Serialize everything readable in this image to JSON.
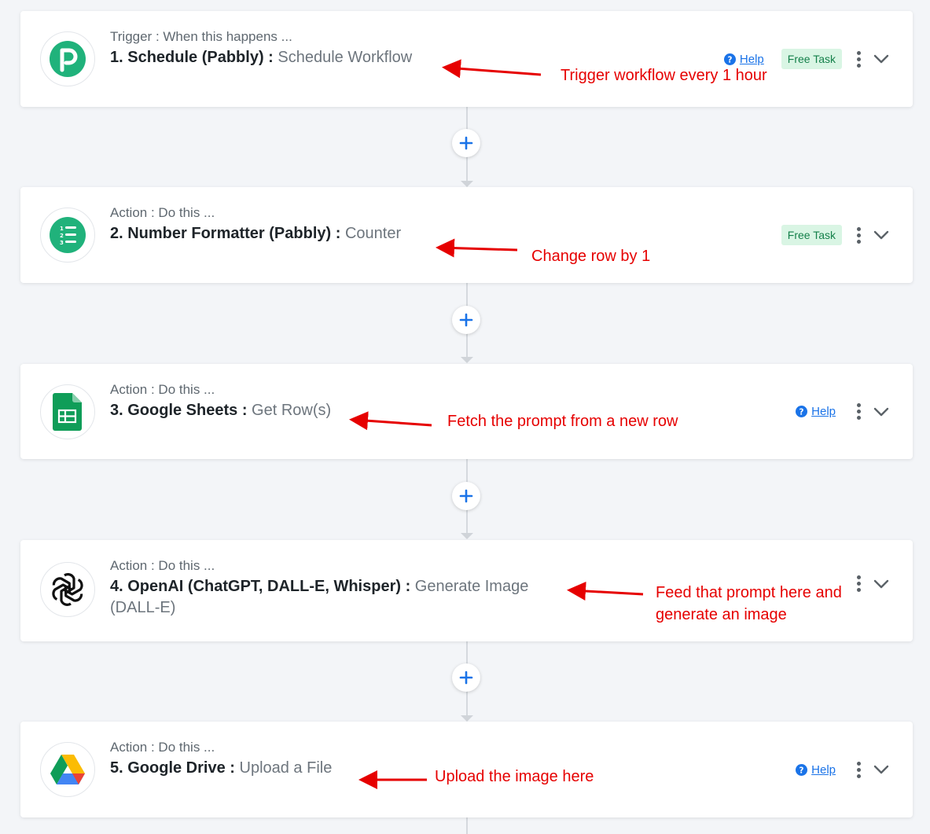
{
  "steps": [
    {
      "type_label": "Trigger : When this happens ...",
      "title": "1. Schedule (Pabbly) :",
      "event": "Schedule Workflow",
      "logo_icon": "pabbly-logo-icon",
      "show_help": true,
      "show_free": true
    },
    {
      "type_label": "Action : Do this ...",
      "title": "2. Number Formatter (Pabbly) :",
      "event": "Counter",
      "logo_icon": "number-formatter-icon",
      "show_help": false,
      "show_free": true
    },
    {
      "type_label": "Action : Do this ...",
      "title": "3. Google Sheets :",
      "event": "Get Row(s)",
      "logo_icon": "google-sheets-icon",
      "show_help": true,
      "show_free": false
    },
    {
      "type_label": "Action : Do this ...",
      "title": "4. OpenAI (ChatGPT, DALL-E, Whisper) :",
      "event": "Generate Image (DALL-E)",
      "logo_icon": "openai-icon",
      "show_help": false,
      "show_free": false
    },
    {
      "type_label": "Action : Do this ...",
      "title": "5. Google Drive :",
      "event": "Upload a File",
      "logo_icon": "google-drive-icon",
      "show_help": true,
      "show_free": false
    }
  ],
  "labels": {
    "help": "Help",
    "free_task": "Free Task"
  },
  "annotations": {
    "a1": "Trigger workflow every 1 hour",
    "a2": "Change row by 1",
    "a3": "Fetch the prompt from a new row",
    "a4_line1": "Feed that prompt here and",
    "a4_line2": "generate an image",
    "a5": "Upload the image here"
  },
  "colors": {
    "accent": "#1a73e8",
    "annotation": "#e60000",
    "free_badge_bg": "#d9f5e4",
    "free_badge_text": "#14804a",
    "pabbly_green": "#20b27b",
    "sheets_green": "#0f9d58"
  }
}
